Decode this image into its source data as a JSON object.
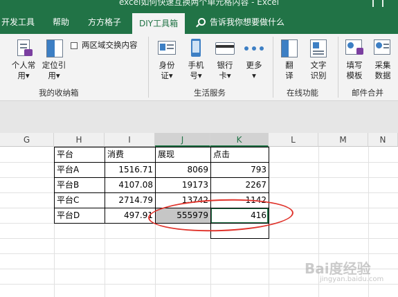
{
  "window": {
    "title": "excel如何快速互换两个单元格内容 - Excel"
  },
  "tabs": [
    {
      "label": "开发工具",
      "active": false
    },
    {
      "label": "帮助",
      "active": false
    },
    {
      "label": "方方格子",
      "active": false
    },
    {
      "label": "DIY工具箱",
      "active": true
    }
  ],
  "tellme": {
    "label": "告诉我你想要做什么"
  },
  "ribbon": {
    "group1": {
      "label": "我的收纳箱",
      "buttons": [
        {
          "line1": "个人常",
          "line2": "用"
        },
        {
          "line1": "定位引",
          "line2": "用"
        }
      ],
      "checkbox_label": "两区域交换内容"
    },
    "group2": {
      "label": "生活服务",
      "buttons": [
        {
          "line1": "身份",
          "line2": "证"
        },
        {
          "line1": "手机",
          "line2": "号"
        },
        {
          "line1": "银行",
          "line2": "卡"
        },
        {
          "line1": "更多",
          "line2": ""
        }
      ]
    },
    "group3": {
      "label": "在线功能",
      "buttons": [
        {
          "line1": "翻",
          "line2": "译"
        },
        {
          "line1": "文字",
          "line2": "识别"
        }
      ]
    },
    "group4": {
      "label": "邮件合并",
      "buttons": [
        {
          "line1": "填写",
          "line2": "模板"
        },
        {
          "line1": "采集",
          "line2": "数据"
        }
      ]
    }
  },
  "grid": {
    "columns": [
      "G",
      "H",
      "I",
      "J",
      "K",
      "L",
      "M",
      "N"
    ],
    "selected_columns": [
      "J",
      "K"
    ],
    "table": {
      "headers": [
        "平台",
        "消费",
        "展现",
        "点击"
      ],
      "rows": [
        [
          "平台A",
          "1516.71",
          "8069",
          "793"
        ],
        [
          "平台B",
          "4107.08",
          "19173",
          "2267"
        ],
        [
          "平台C",
          "2714.79",
          "13742",
          "1142"
        ],
        [
          "平台D",
          "497.91",
          "555979",
          "416"
        ]
      ]
    }
  },
  "watermark": {
    "brand": "Bai度经验",
    "url": "jingyan.baidu.com"
  },
  "colors": {
    "excel_green": "#217346",
    "annotation_red": "#e0342c"
  }
}
